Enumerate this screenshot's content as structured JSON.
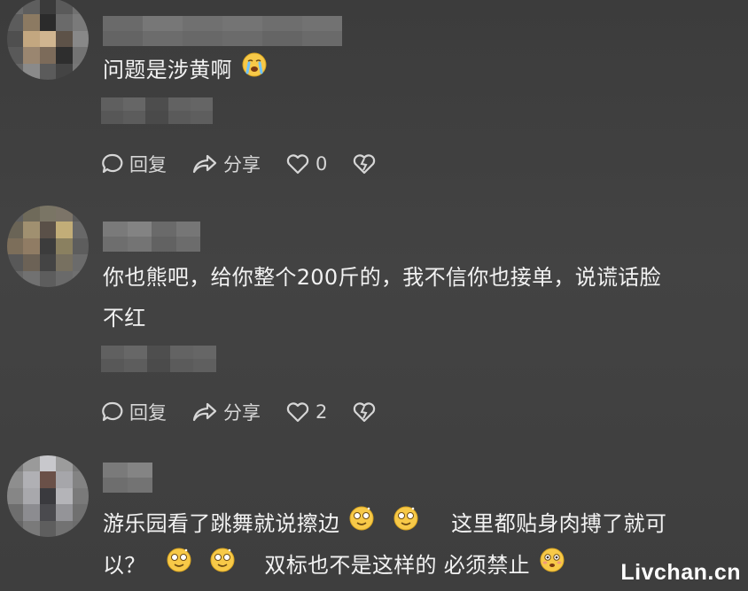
{
  "comments": [
    {
      "text": "问题是涉黄啊",
      "reply_label": "回复",
      "share_label": "分享",
      "like_count": "0"
    },
    {
      "text_line1": "你也熊吧，给你整个200斤的，我不信你也接单，说谎话脸",
      "text_line2": "不红",
      "reply_label": "回复",
      "share_label": "分享",
      "like_count": "2"
    },
    {
      "line1_a": "游乐园看了跳舞就说擦边",
      "line1_b": "这里都贴身肉搏了就可",
      "line2_a": "以？",
      "line2_b": "双标也不是这样的 必须禁止"
    }
  ],
  "watermark": "Livchan.cn",
  "icons": [
    "comment-bubble-icon",
    "share-arrow-icon",
    "heart-icon",
    "broken-heart-icon",
    "crying-emoji-icon",
    "dizzy-emoji-icon",
    "flushed-emoji-icon"
  ],
  "colors": {
    "background": "#3f3f3f",
    "text": "#f2f2f2",
    "action": "#d6d6d6"
  }
}
